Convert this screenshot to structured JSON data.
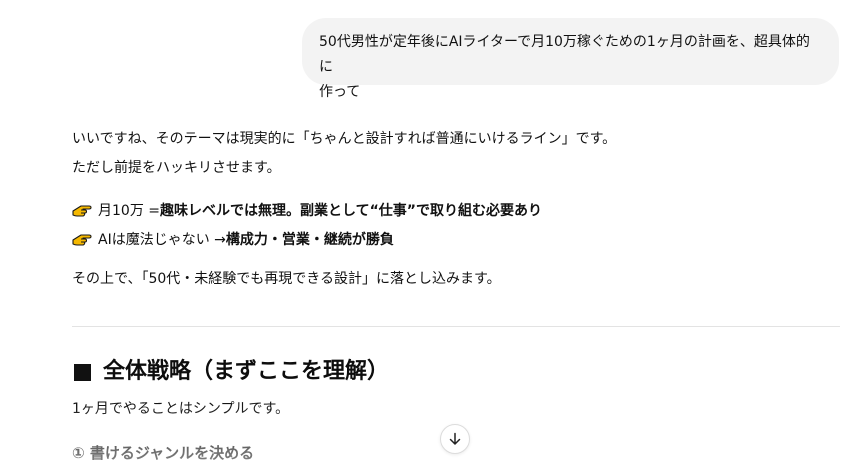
{
  "user_message": {
    "line1": "50代男性が定年後にAIライターで月10万稼ぐための1ヶ月の計画を、超具体的に",
    "line2": "作って"
  },
  "assistant": {
    "intro_line1": "いいですね、そのテーマは現実的に「ちゃんと設計すれば普通にいけるライン」です。",
    "intro_line2": "ただし前提をハッキリさせます。",
    "bullets": [
      {
        "icon": "pointing-hand-icon",
        "plain": "月10万 = ",
        "bold": "趣味レベルでは無理。副業として“仕事”で取り組む必要あり"
      },
      {
        "icon": "pointing-hand-icon",
        "plain": "AIは魔法じゃない → ",
        "bold": "構成力・営業・継続が勝負"
      }
    ],
    "closing": "その上で、「50代・未経験でも再現できる設計」に落とし込みます。",
    "section_heading": "全体戦略（まずここを理解）",
    "section_intro": "1ヶ月でやることはシンプルです。",
    "step1": "① 書けるジャンルを決める"
  },
  "controls": {
    "scroll_down_icon": "arrow-down-icon"
  },
  "colors": {
    "user_bubble_bg": "#f3f3f3",
    "hand_icon": "#f5b800",
    "text": "#111111"
  }
}
